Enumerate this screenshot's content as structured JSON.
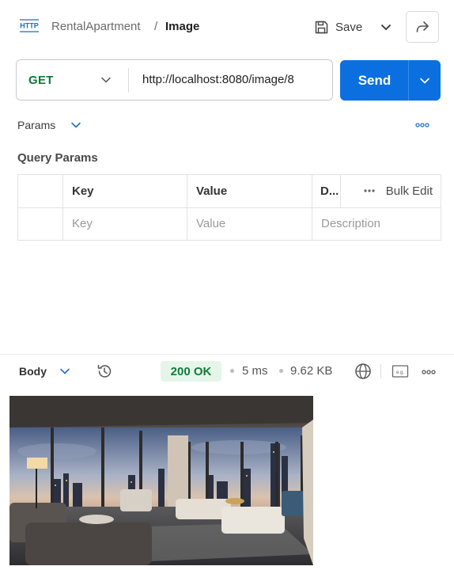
{
  "header": {
    "collection": "RentalApartment",
    "separator": "/",
    "request_name": "Image",
    "save_label": "Save",
    "http_badge": "HTTP"
  },
  "request": {
    "method": "GET",
    "url": "http://localhost:8080/image/8",
    "send_label": "Send"
  },
  "params": {
    "tab_label": "Params",
    "section_title": "Query Params",
    "columns": [
      "Key",
      "Value",
      "D..."
    ],
    "bulk_edit_label": "Bulk Edit",
    "placeholders": [
      "Key",
      "Value",
      "Description"
    ]
  },
  "response": {
    "body_label": "Body",
    "status": "200 OK",
    "time": "5 ms",
    "size": "9.62 KB",
    "status_color": "#137a3a"
  },
  "colors": {
    "accent": "#0b6fe0",
    "method_get": "#0d7a35"
  },
  "icons": [
    "http-icon",
    "save-icon",
    "chevron-down-icon",
    "share-icon",
    "more-icon",
    "history-icon",
    "globe-icon",
    "save-response-icon"
  ]
}
